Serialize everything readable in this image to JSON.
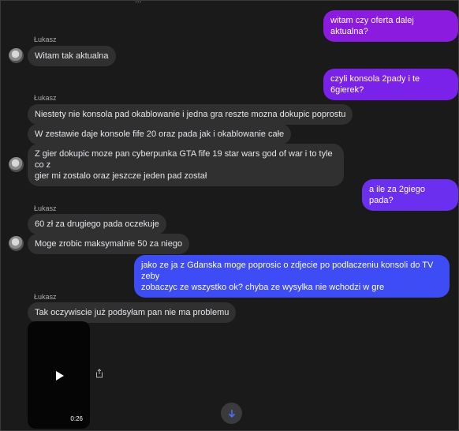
{
  "top_fragment": "...",
  "contact_name": "Łukasz",
  "messages": {
    "m1": "witam czy oferta dalej aktualna?",
    "m2": "Witam tak aktualna",
    "m3": "czyli konsola 2pady i te 6gierek?",
    "m4": "Niestety nie konsola pad okablowanie i jedna gra reszte mozna dokupic poprostu",
    "m5": "W zestawie daje konsole fife 20 oraz pada jak i okablowanie całe",
    "m6_line1": "Z gier dokupic moze pan cyberpunka GTA fife 19 star wars god of war i to tyle co z",
    "m6_line2": "gier mi zostalo oraz jeszcze jeden pad został",
    "m7": "a ile za 2giego pada?",
    "m8": "60 zł za drugiego pada oczekuje",
    "m9": "Moge zrobic maksymalnie 50 za niego",
    "m10_line1": "jako ze ja z Gdanska moge poprosic o zdjecie po podlaczeniu konsoli do TV zeby",
    "m10_line2": "zobaczyc ze wszystko ok? chyba ze wysylka nie wchodzi w gre",
    "m11": "Tak oczywiscie już podsyłam pan nie ma problemu"
  },
  "video": {
    "duration": "0:26"
  },
  "colors": {
    "outgoing_a": "#8c1be0",
    "outgoing_b": "#6b2ff0",
    "outgoing_c": "#3d4cf5",
    "incoming": "#303030",
    "background": "#1a1a1a"
  },
  "icons": {
    "avatar": "avatar-photo",
    "play": "play-icon",
    "share": "share-icon",
    "scroll": "arrow-down-icon"
  }
}
